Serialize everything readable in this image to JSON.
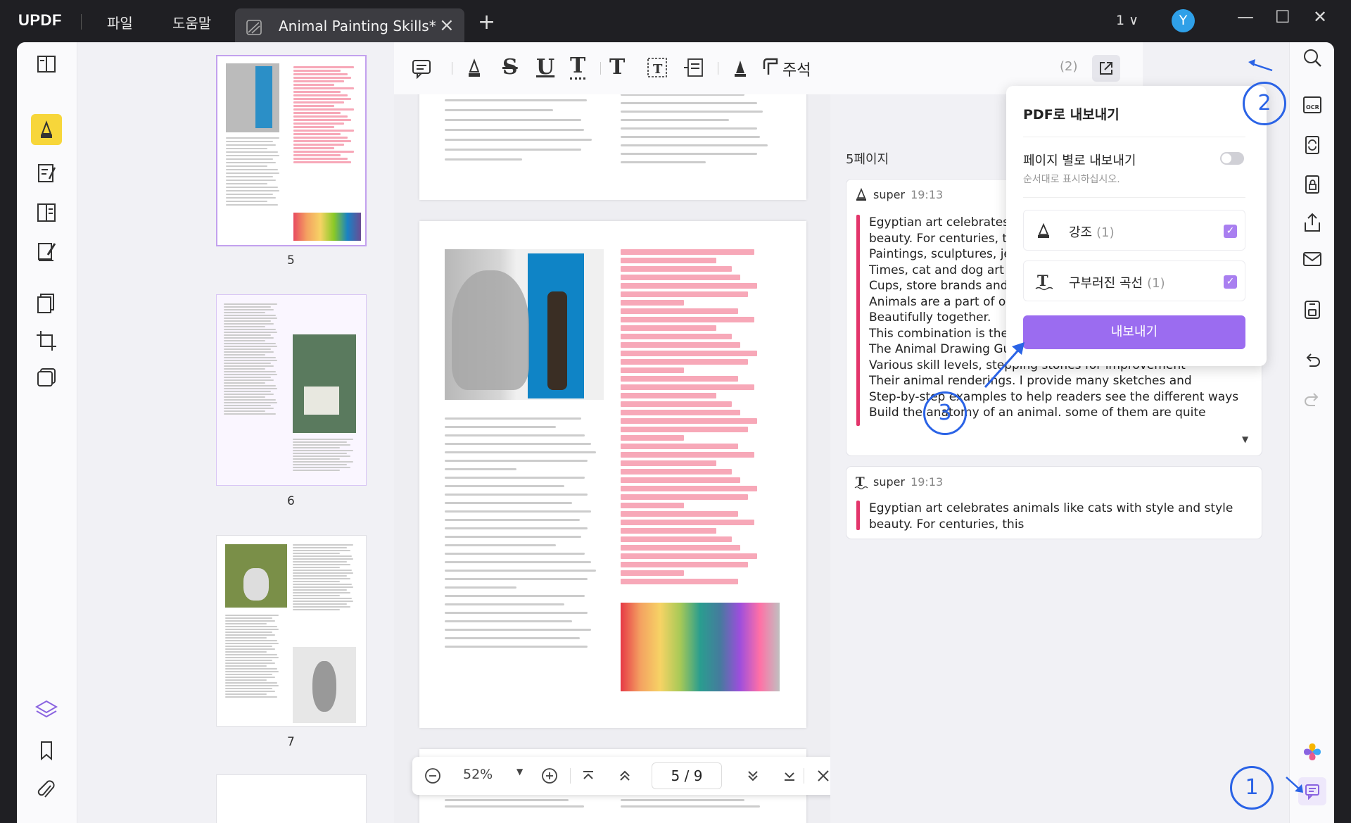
{
  "app": {
    "logo": "UPDF",
    "menu_file": "파일",
    "menu_help": "도움말"
  },
  "tab": {
    "title": "Animal Painting Skills*",
    "close": "×",
    "new": "+"
  },
  "titlebar": {
    "page_indicator": "1 ∨",
    "avatar": "Y",
    "min": "—",
    "max": "☐",
    "close": "✕"
  },
  "toolbar": {
    "comment_label": "주석",
    "count": "(2)"
  },
  "thumbnails": {
    "labels": [
      "5",
      "6",
      "7"
    ]
  },
  "zoom": {
    "value": "52%",
    "current_page": "5",
    "total_pages": "9",
    "separator": "/"
  },
  "comments": {
    "page_header": "5페이지",
    "items": [
      {
        "author": "super",
        "time": "19:13",
        "lines": [
          "Egyptian art celebrates animals like cats with style and style",
          "beauty. For centuries, this horse has inspired",
          "Paintings, sculptures, jewelry, and even armor. nowadays",
          "Times, cat and dog art sells a lot of t-shirts, calendars, coffee",
          "Cups, store brands and other items. Whether it is art or domestic",
          "Animals are a part of our daily life, the combination of the two",
          "Beautifully together.",
          "This combination is the subject of this book. artist's",
          "The Animal Drawing Guide aims to provide people with",
          "Various skill levels, stepping stones for improvement",
          "Their animal renderings. I provide many sketches and",
          "Step-by-step examples to help readers see the different ways",
          "Build the anatomy of an animal. some of them are quite"
        ]
      },
      {
        "author": "super",
        "time": "19:13",
        "lines": [
          "Egyptian art celebrates animals like cats with style and style",
          "beauty. For centuries, this"
        ]
      }
    ]
  },
  "export_popup": {
    "title": "PDF로 내보내기",
    "per_page_label": "페이지 별로 내보내기",
    "per_page_hint": "순서대로 표시하십시오.",
    "options": [
      {
        "label": "강조",
        "count": "(1)",
        "checked": "✓"
      },
      {
        "label": "구부러진 곡선",
        "count": "(1)",
        "checked": "✓"
      }
    ],
    "export_button": "내보내기"
  },
  "callouts": [
    "1",
    "2",
    "3"
  ],
  "colors": {
    "accent": "#9b6cf0",
    "highlight": "#f7a8b8",
    "annotation_blue": "#2a63e6"
  }
}
